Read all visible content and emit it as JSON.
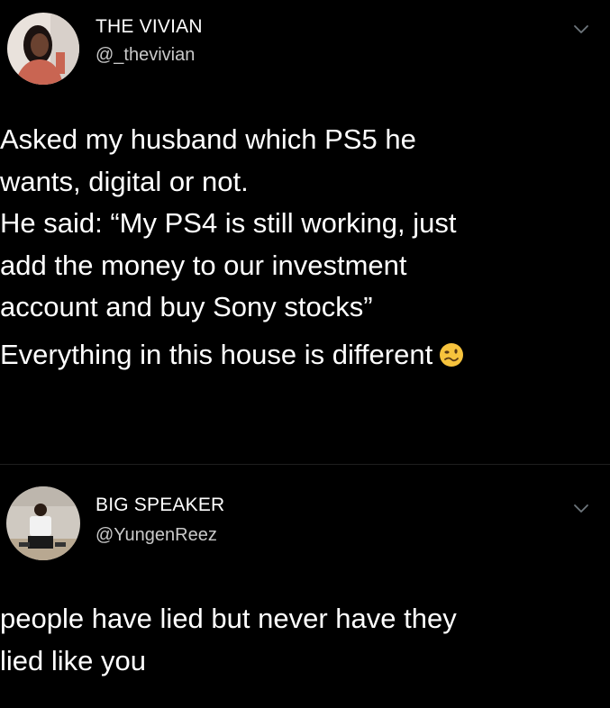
{
  "tweets": [
    {
      "display_name": "THE VIVIAN",
      "handle": "@_thevivian",
      "text_lines": [
        "Asked my husband which PS5 he",
        "wants, digital or not.",
        "He said: “My PS4 is still working, just",
        "add the money to our investment",
        "account and buy Sony stocks”"
      ],
      "final_line": "Everything in this house is different",
      "final_emoji": "woozy-face-icon"
    },
    {
      "display_name": "BIG SPEAKER",
      "handle": "@YungenReez",
      "text_lines": [
        "people have lied but never have they",
        "lied like you"
      ]
    }
  ],
  "colors": {
    "background": "#000000",
    "text": "#ffffff",
    "handle": "#c9c9c9",
    "chevron": "#6e767d",
    "divider": "#1f1f1f"
  }
}
